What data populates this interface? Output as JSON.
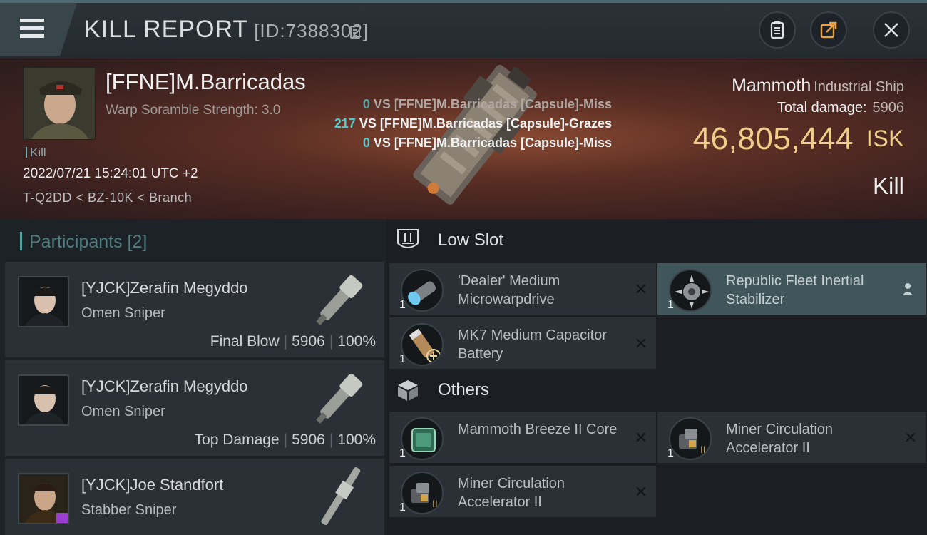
{
  "header": {
    "title": "KILL REPORT",
    "report_id": "[ID:7388302]",
    "icons": [
      "menu-icon",
      "copy-icon",
      "clipboard-icon",
      "share-icon",
      "close-icon"
    ]
  },
  "victim": {
    "name": "[FFNE]M.Barricadas",
    "warp_scramble": "Warp Soramble Strength: 3.0",
    "tag": "Kill",
    "datetime": "2022/07/21 15:24:01 UTC +2",
    "route": "T-Q2DD < BZ-10K < Branch"
  },
  "hits": [
    {
      "dmg": "0",
      "text": "VS [FFNE]M.Barricadas [Capsule]-Miss"
    },
    {
      "dmg": "217",
      "text": "VS [FFNE]M.Barricadas [Capsule]-Grazes"
    },
    {
      "dmg": "0",
      "text": "VS [FFNE]M.Barricadas [Capsule]-Miss"
    }
  ],
  "ship": {
    "name": "Mammoth",
    "class": "Industrial Ship",
    "total_damage_label": "Total damage:",
    "total_damage": "5906",
    "isk_value": "46,805,444",
    "isk_unit": "ISK",
    "result": "Kill"
  },
  "participants": {
    "heading": "Participants [2]",
    "list": [
      {
        "name": "[YJCK]Zerafin Megyddo",
        "ship": "Omen Sniper",
        "role": "Final Blow",
        "damage": "5906",
        "percent": "100%"
      },
      {
        "name": "[YJCK]Zerafin Megyddo",
        "ship": "Omen Sniper",
        "role": "Top Damage",
        "damage": "5906",
        "percent": "100%"
      },
      {
        "name": "[YJCK]Joe Standfort",
        "ship": "Stabber Sniper"
      }
    ]
  },
  "sections": {
    "low_slot": "Low Slot",
    "others": "Others"
  },
  "items": {
    "low_slot": [
      {
        "name": "'Dealer' Medium Microwarpdrive",
        "qty": "1"
      },
      {
        "name": "Republic Fleet Inertial Stabilizer",
        "qty": "1"
      },
      {
        "name": "MK7 Medium Capacitor Battery",
        "qty": "1"
      }
    ],
    "others": [
      {
        "name": "Mammoth Breeze II Core",
        "qty": "1"
      },
      {
        "name": "Miner Circulation Accelerator II",
        "qty": "1"
      },
      {
        "name": "Miner Circulation Accelerator II",
        "qty": "1"
      }
    ]
  },
  "colors": {
    "accent": "#5aa7a8",
    "isk": "#f0cf8a",
    "damage": "#55c9c9"
  }
}
